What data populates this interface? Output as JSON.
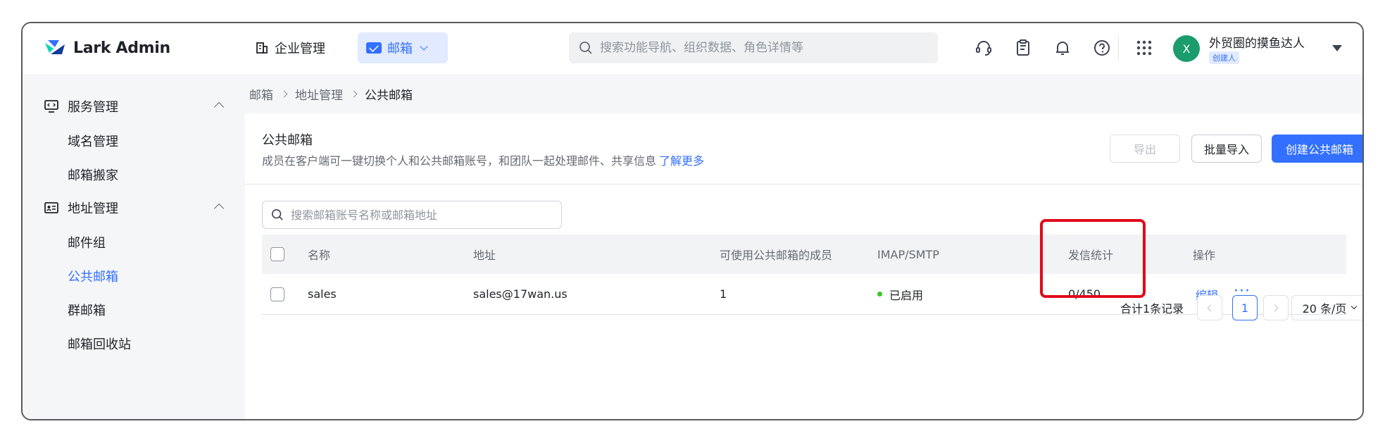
{
  "app": {
    "logo_text": "Lark Admin"
  },
  "topnav": {
    "org_label": "企业管理",
    "mail_label": "邮箱",
    "search_placeholder": "搜索功能导航、组织数据、角色详情等"
  },
  "user": {
    "avatar_letter": "X",
    "name": "外贸圈的摸鱼达人",
    "role": "创建人"
  },
  "sidebar": {
    "groups": [
      {
        "label": "服务管理",
        "icon": "monitor-icon",
        "items": [
          "域名管理",
          "邮箱搬家"
        ]
      },
      {
        "label": "地址管理",
        "icon": "id-card-icon",
        "items": [
          "邮件组",
          "公共邮箱",
          "群邮箱",
          "邮箱回收站"
        ]
      }
    ],
    "active_item": "公共邮箱"
  },
  "breadcrumb": [
    "邮箱",
    "地址管理",
    "公共邮箱"
  ],
  "page": {
    "title": "公共邮箱",
    "description": "成员在客户端可一键切换个人和公共邮箱账号，和团队一起处理邮件、共享信息",
    "learn_more": "了解更多",
    "btn_export": "导出",
    "btn_import": "批量导入",
    "btn_create": "创建公共邮箱"
  },
  "table": {
    "search_placeholder": "搜索邮箱账号名称或邮箱地址",
    "columns": [
      "名称",
      "地址",
      "可使用公共邮箱的成员",
      "IMAP/SMTP",
      "发信统计",
      "操作"
    ],
    "rows": [
      {
        "name": "sales",
        "address": "sales@17wan.us",
        "members": "1",
        "imap": "已启用",
        "stats": "0/450",
        "edit": "编辑",
        "more": "···"
      }
    ]
  },
  "pagination": {
    "total_text": "合计1条记录",
    "current_page": "1",
    "page_size": "20 条/页"
  },
  "colors": {
    "primary": "#3370ff",
    "highlight": "#e00b1c",
    "status_green": "#34c724"
  }
}
